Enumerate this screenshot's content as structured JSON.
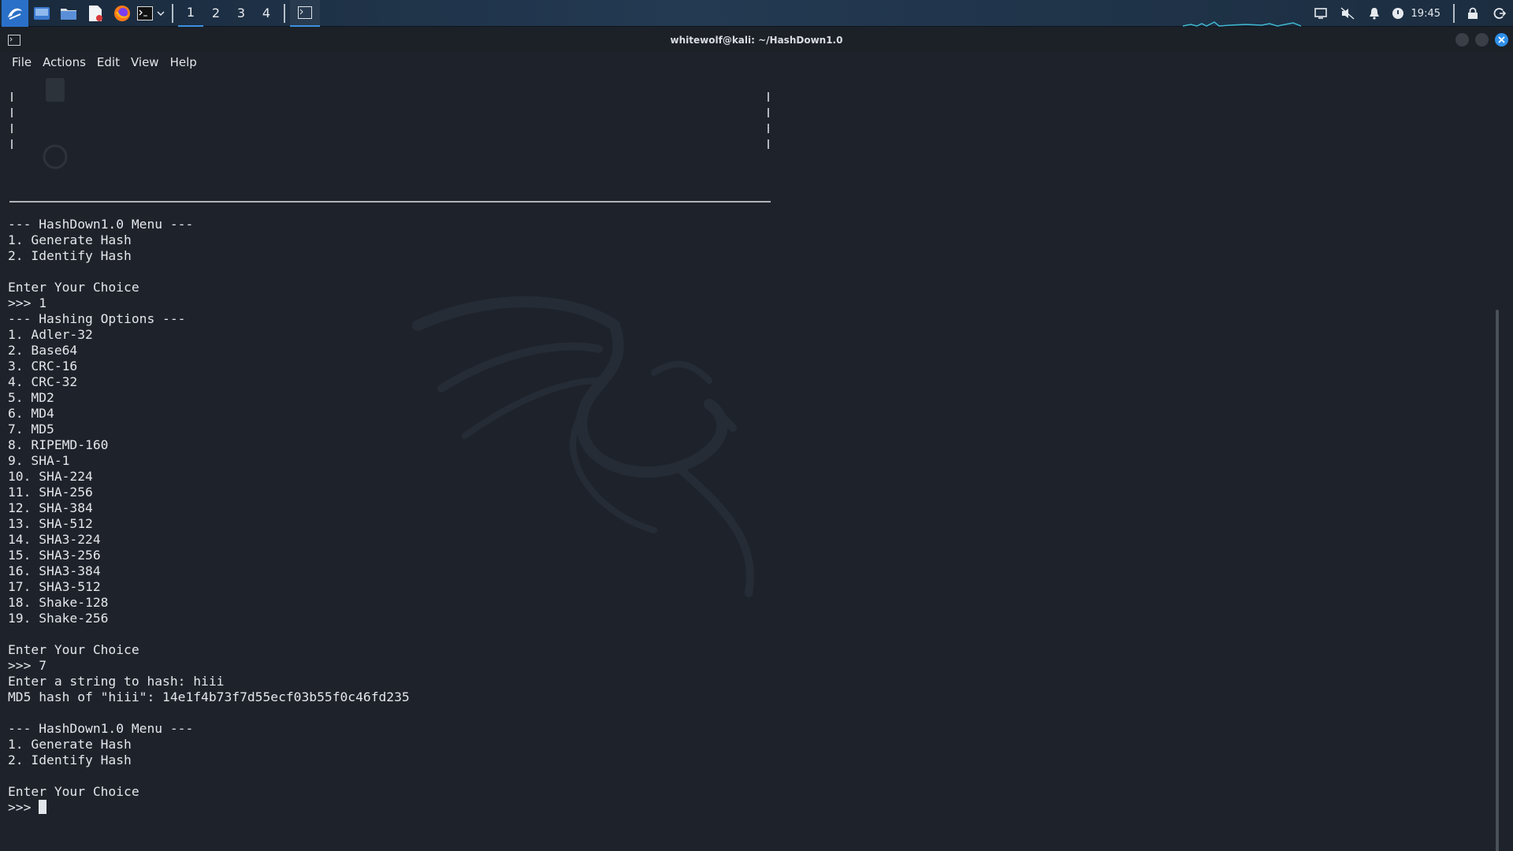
{
  "taskbar": {
    "workspaces": [
      "1",
      "2",
      "3",
      "4"
    ],
    "active_workspace": "1",
    "clock": "19:45",
    "launchers": [
      "kali-menu",
      "desktop",
      "file-manager",
      "text-editor",
      "firefox",
      "terminal"
    ]
  },
  "window": {
    "title": "whitewolf@kali: ~/HashDown1.0",
    "menu": [
      "File",
      "Actions",
      "Edit",
      "View",
      "Help"
    ]
  },
  "terminal": {
    "lines": [
      "--- HashDown1.0 Menu ---",
      "1. Generate Hash",
      "2. Identify Hash",
      "",
      "Enter Your Choice",
      ">>> 1",
      "--- Hashing Options ---",
      "1. Adler-32",
      "2. Base64",
      "3. CRC-16",
      "4. CRC-32",
      "5. MD2",
      "6. MD4",
      "7. MD5",
      "8. RIPEMD-160",
      "9. SHA-1",
      "10. SHA-224",
      "11. SHA-256",
      "12. SHA-384",
      "13. SHA-512",
      "14. SHA3-224",
      "15. SHA3-256",
      "16. SHA3-384",
      "17. SHA3-512",
      "18. Shake-128",
      "19. Shake-256",
      "",
      "Enter Your Choice",
      ">>> 7",
      "Enter a string to hash: hiii",
      "MD5 hash of \"hiii\": 14e1f4b73f7d55ecf03b55f0c46fd235",
      "",
      "--- HashDown1.0 Menu ---",
      "1. Generate Hash",
      "2. Identify Hash",
      "",
      "Enter Your Choice"
    ],
    "prompt": ">>> "
  },
  "colors": {
    "terminal_bg": "#1e232b",
    "text": "#e3e6ea",
    "accent": "#2f8fe8"
  }
}
